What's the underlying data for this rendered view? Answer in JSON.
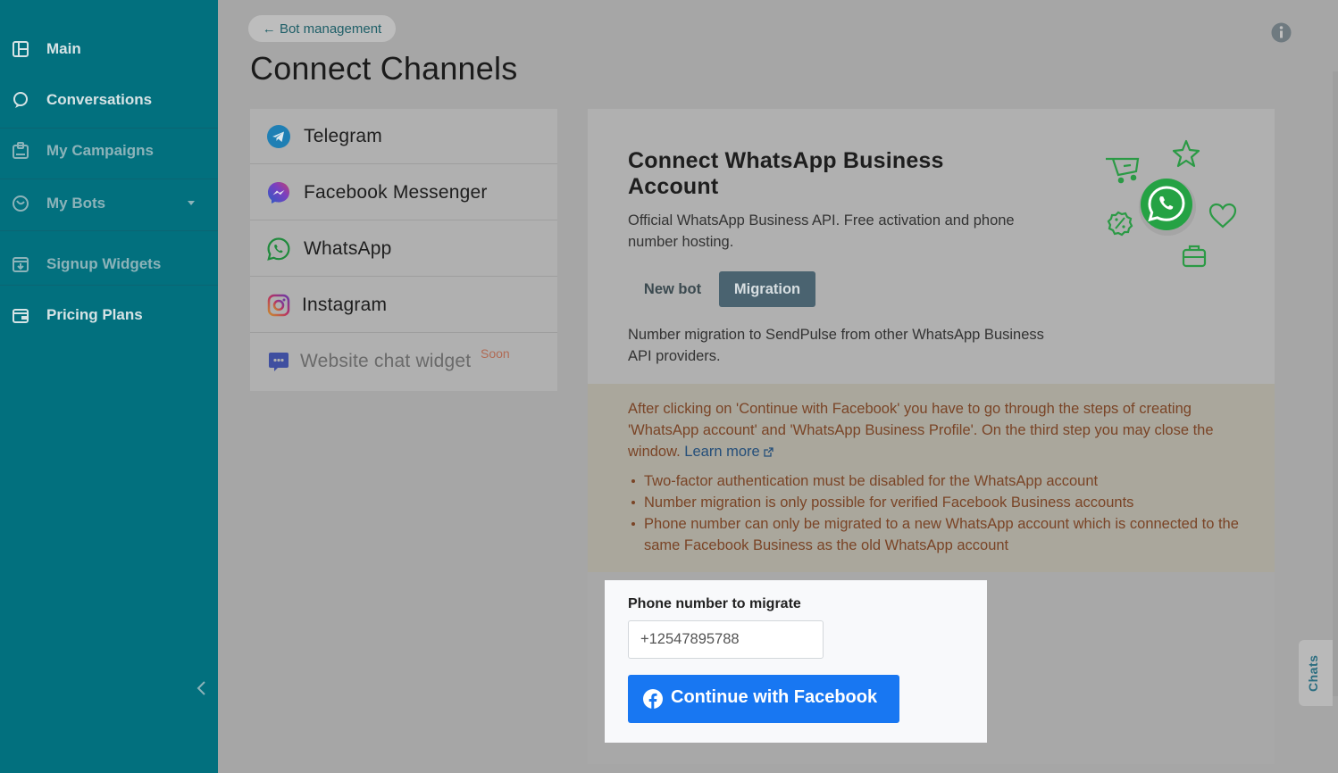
{
  "sidebar": {
    "items": [
      {
        "label": "Main",
        "icon": "dashboard-icon"
      },
      {
        "label": "Conversations",
        "icon": "chat-bubble-icon"
      },
      {
        "label": "My Campaigns",
        "icon": "campaign-icon"
      },
      {
        "label": "My Bots",
        "icon": "bot-icon"
      },
      {
        "label": "Signup Widgets",
        "icon": "widget-icon"
      },
      {
        "label": "Pricing Plans",
        "icon": "wallet-icon"
      }
    ]
  },
  "header": {
    "back_label": "← Bot management",
    "title": "Connect Channels"
  },
  "channels": [
    {
      "label": "Telegram",
      "icon": "telegram-icon"
    },
    {
      "label": "Facebook Messenger",
      "icon": "messenger-icon"
    },
    {
      "label": "WhatsApp",
      "icon": "whatsapp-icon"
    },
    {
      "label": "Instagram",
      "icon": "instagram-icon"
    },
    {
      "label": "Website chat widget",
      "icon": "chat-widget-icon",
      "badge": "Soon"
    }
  ],
  "panel": {
    "title": "Connect WhatsApp Business Account",
    "description": "Official WhatsApp Business API. Free activation and phone number hosting.",
    "tabs": {
      "new_bot": "New bot",
      "migration": "Migration"
    },
    "migration_note": "Number migration to SendPulse from other WhatsApp Business API providers.",
    "warning": {
      "text": "After clicking on 'Continue with Facebook' you have to go through the steps of creating 'WhatsApp account' and 'WhatsApp Business Profile'. On the third step you may close the window.",
      "learn_more": "Learn more",
      "bullets": [
        "Two-factor authentication must be disabled for the WhatsApp account",
        "Number migration is only possible for verified Facebook Business accounts",
        "Phone number can only be migrated to a new WhatsApp account which is connected to the same Facebook Business as the old WhatsApp account"
      ]
    },
    "form": {
      "label": "Phone number to migrate",
      "phone_value": "+12547895788",
      "button_label": "Continue with Facebook"
    }
  },
  "chats_tab": "Chats",
  "colors": {
    "sidebar": "#02707e",
    "facebook_blue": "#1877f2",
    "whatsapp_green": "#25a244",
    "warning_text": "#7a4426"
  }
}
